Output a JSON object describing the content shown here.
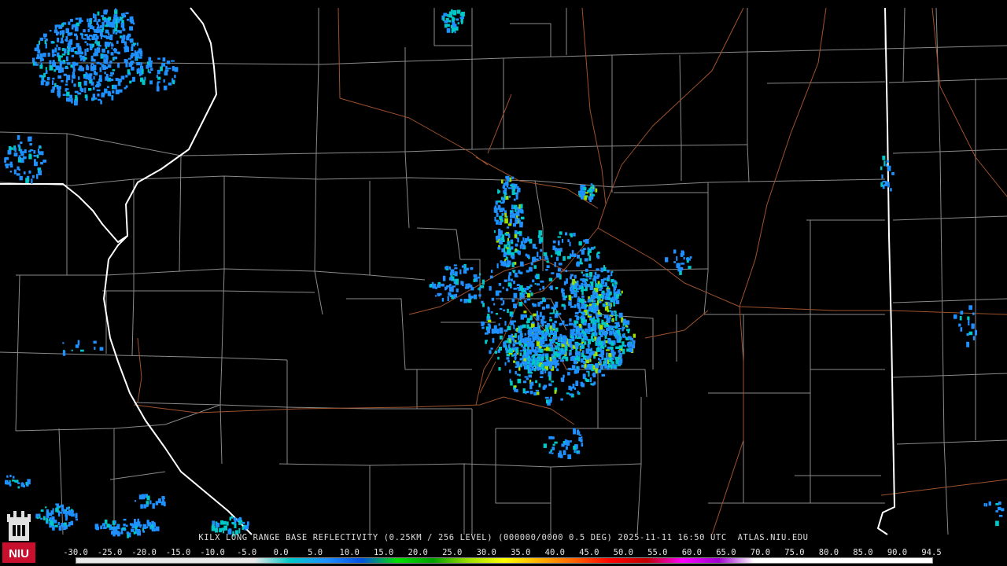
{
  "header": {
    "caption": "KILX LONG RANGE BASE REFLECTIVITY (0.25KM / 256 LEVEL) (000000/0000 0.5 DEG) 2025-11-11 16:50 UTC  ATLAS.NIU.EDU"
  },
  "logo": {
    "text": "NIU",
    "icon": "niu-castle-logo-icon"
  },
  "legend": {
    "labels": [
      "-30.0",
      "-25.0",
      "-20.0",
      "-15.0",
      "-10.0",
      "-5.0",
      "0.0",
      "5.0",
      "10.0",
      "15.0",
      "20.0",
      "25.0",
      "30.0",
      "35.0",
      "40.0",
      "45.0",
      "50.0",
      "55.0",
      "60.0",
      "65.0",
      "70.0",
      "75.0",
      "80.0",
      "85.0",
      "90.0",
      "94.5"
    ],
    "colors": [
      "#e8e8e8",
      "#e8e8e8",
      "#e8e8e8",
      "#e8e8e8",
      "#e8e8e8",
      "#e8e8e8",
      "#00c8c8",
      "#1e90ff",
      "#0050e0",
      "#00e000",
      "#00a000",
      "#a0e000",
      "#ffff00",
      "#ffb000",
      "#ff6000",
      "#ff0000",
      "#c00000",
      "#ff00ff",
      "#a000d0",
      "#ffffff",
      "#ffffff",
      "#ffffff",
      "#ffffff",
      "#ffffff",
      "#ffffff"
    ]
  },
  "map_colors": {
    "state_border": "#ffffff",
    "county_line": "#8a8a8a",
    "highway": "#a0522d",
    "echo_light": "#1e90ff",
    "echo_medium": "#00c8c8",
    "echo_strong": "#a0e000"
  }
}
